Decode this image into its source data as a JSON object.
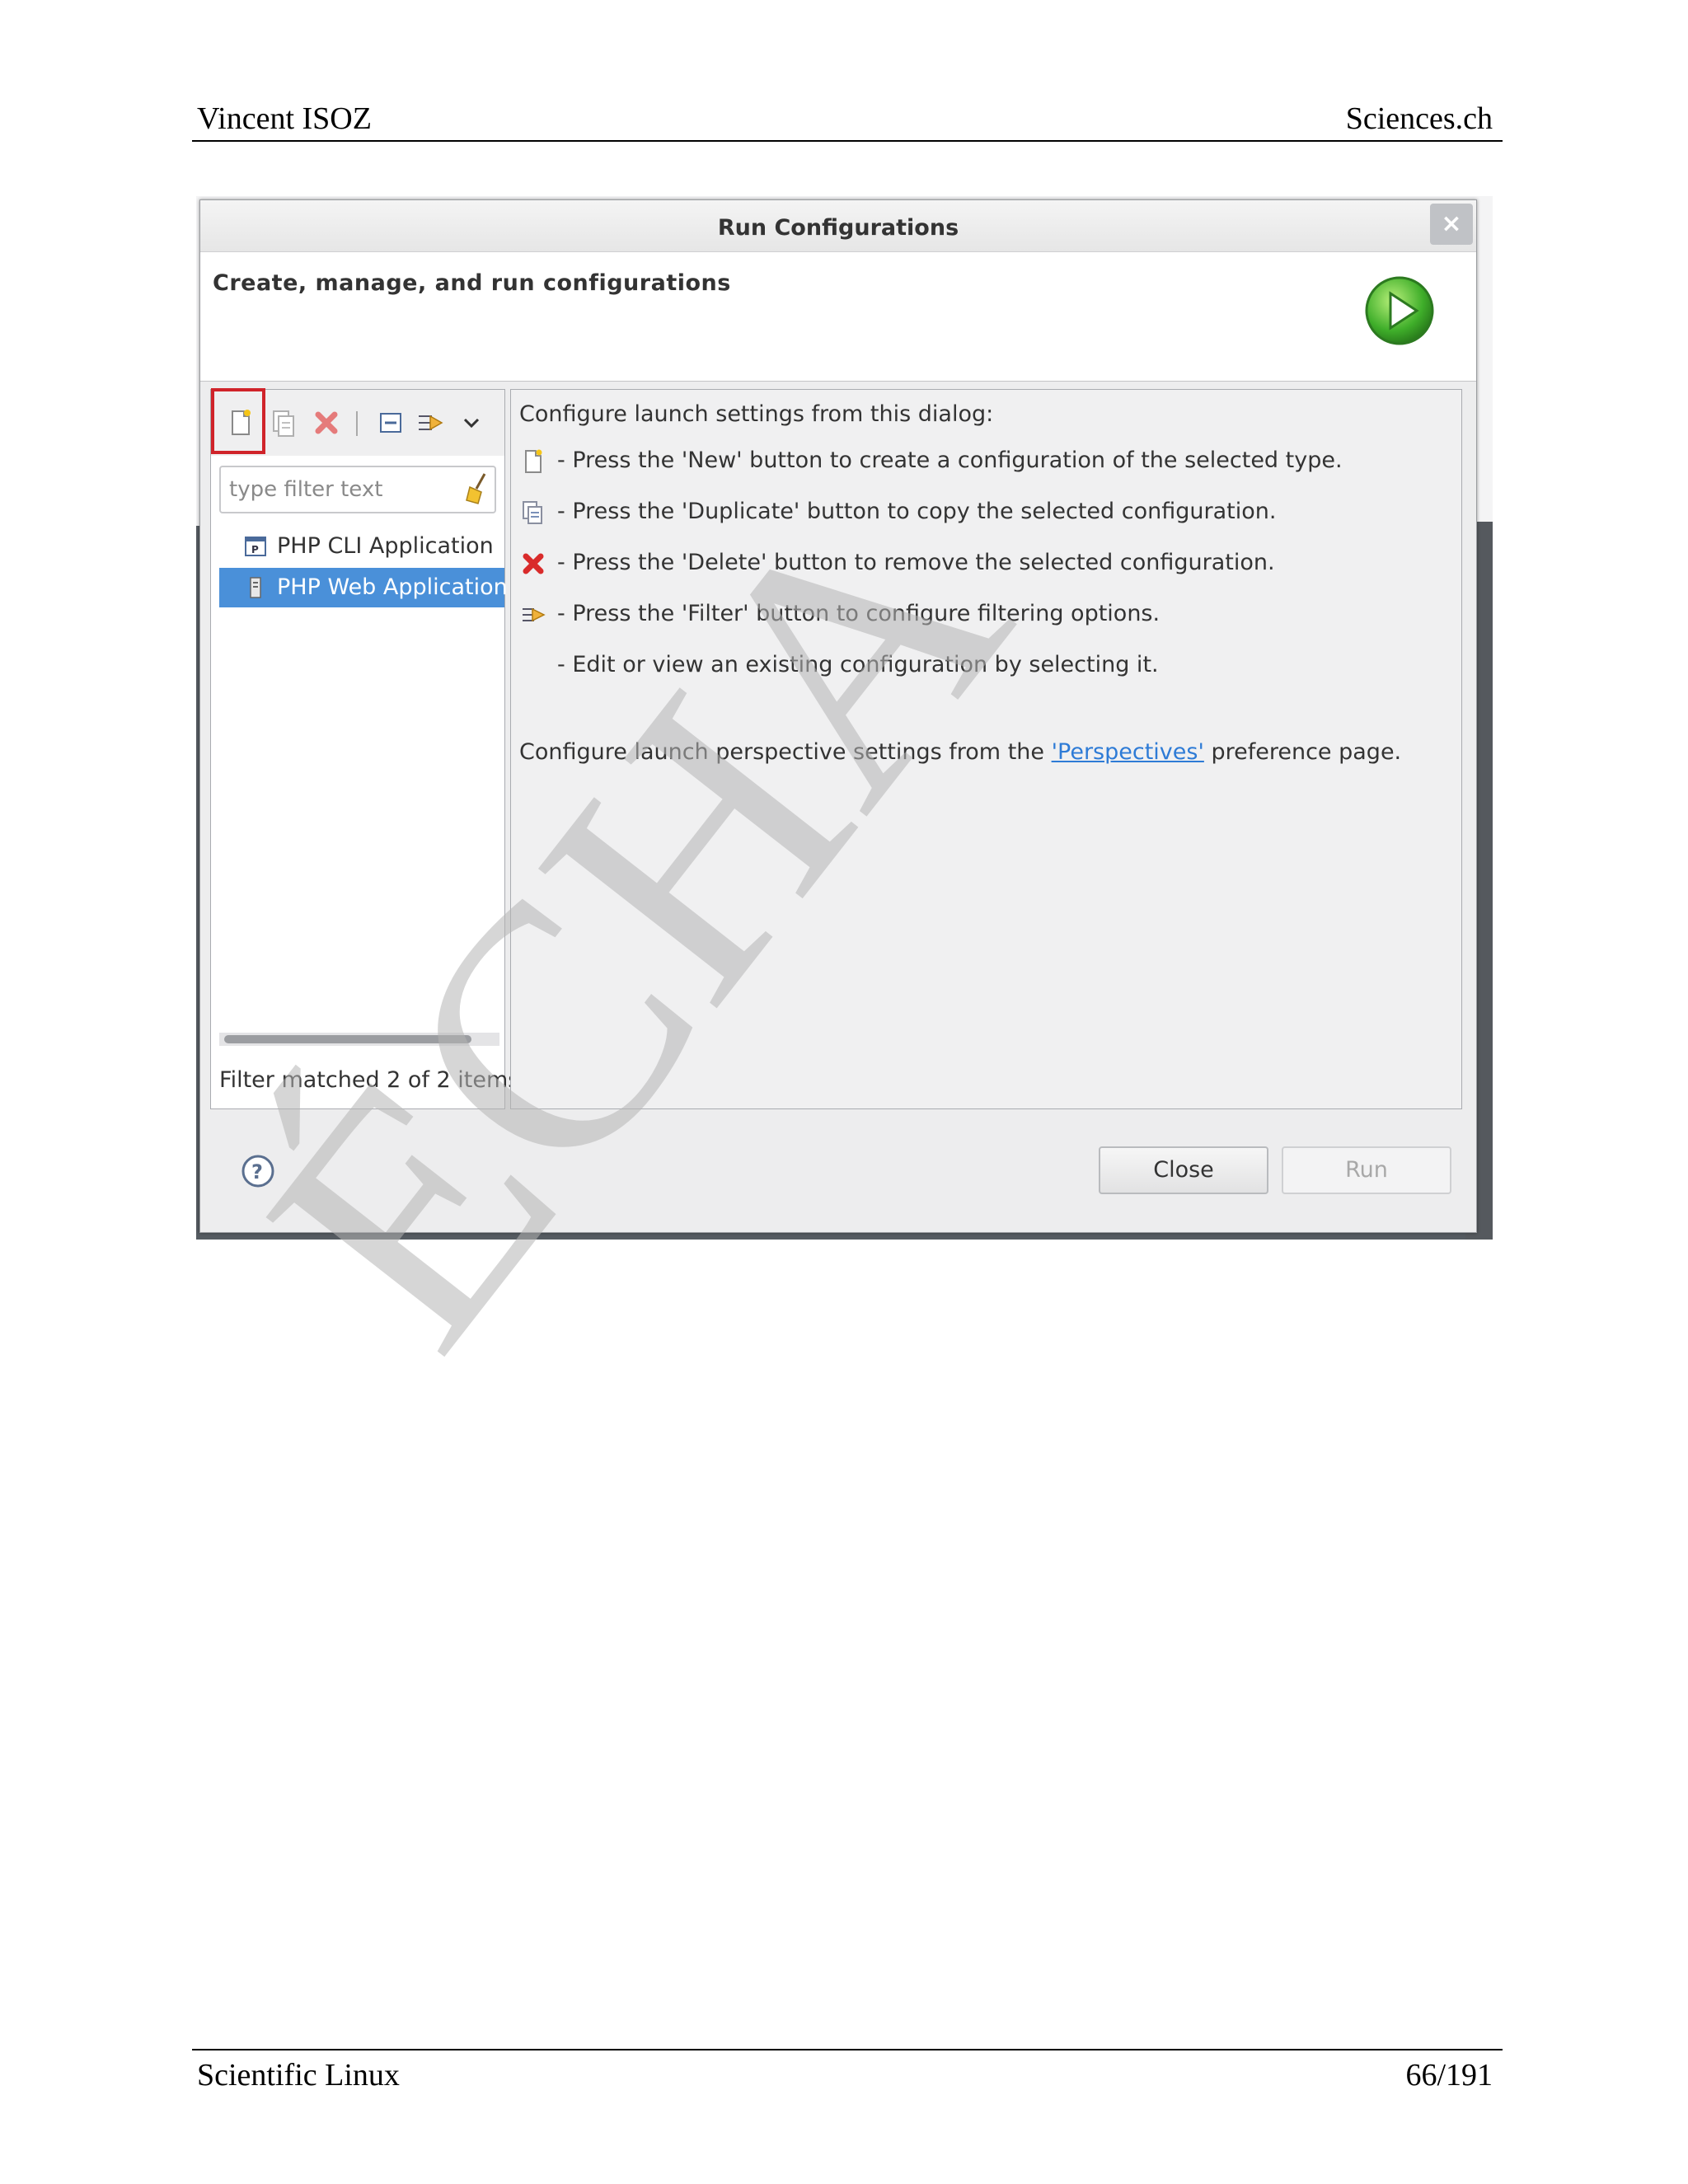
{
  "page": {
    "header_left": "Vincent ISOZ",
    "header_right": "Sciences.ch",
    "footer_left": "Scientific Linux",
    "footer_right": "66/191",
    "watermark": "ÉCHA"
  },
  "dialog": {
    "title": "Run Configurations",
    "close_glyph": "×",
    "banner_text": "Create, manage, and run configurations"
  },
  "left_pane": {
    "filter_placeholder": "type filter text",
    "tree_items": [
      {
        "label": "PHP CLI Application",
        "selected": false
      },
      {
        "label": "PHP Web Application",
        "selected": true
      }
    ],
    "filter_status": "Filter matched 2 of 2 items"
  },
  "right_pane": {
    "intro": "Configure launch settings from this dialog:",
    "instructions": [
      {
        "icon": "new-config-icon",
        "text": "- Press the 'New' button to create a configuration of the selected type."
      },
      {
        "icon": "duplicate-icon",
        "text": "- Press the 'Duplicate' button to copy the selected configuration."
      },
      {
        "icon": "delete-icon",
        "text": "- Press the 'Delete' button to remove the selected configuration."
      },
      {
        "icon": "filter-icon",
        "text": "- Press the 'Filter' button to configure filtering options."
      },
      {
        "icon": "",
        "text": "- Edit or view an existing configuration by selecting it."
      }
    ],
    "perspective_prefix": "Configure launch perspective settings from the ",
    "perspective_link": "'Perspectives'",
    "perspective_suffix": " preference page."
  },
  "buttons": {
    "close": "Close",
    "run": "Run"
  },
  "colors": {
    "selection": "#4a90d9",
    "highlight": "#d0232a",
    "link": "#2e7bd6"
  }
}
